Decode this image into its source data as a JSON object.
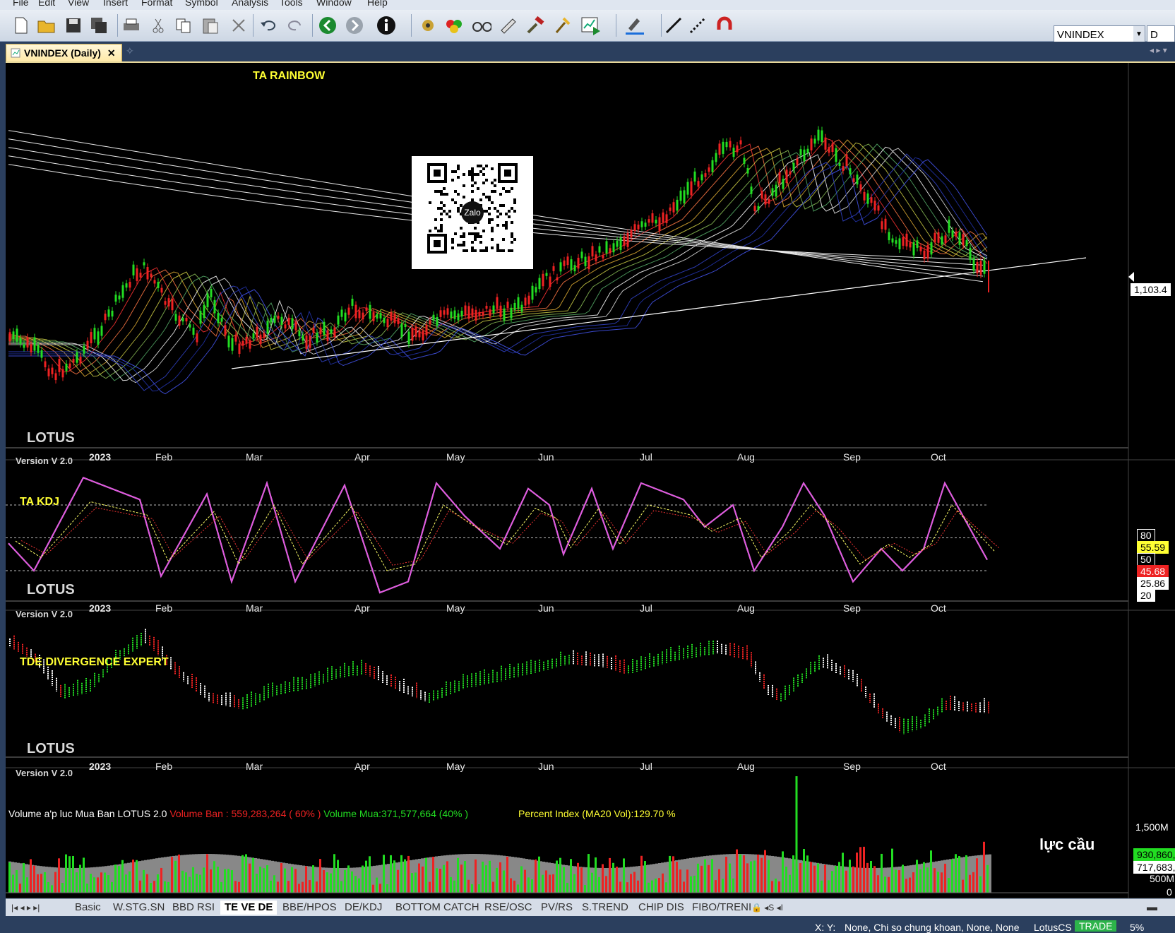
{
  "menu": [
    "File",
    "Edit",
    "View",
    "Insert",
    "Format",
    "Symbol",
    "Analysis",
    "Tools",
    "Window",
    "Help"
  ],
  "toolbar": {
    "icons": [
      "new-file-icon",
      "open-folder-icon",
      "save-icon",
      "save-all-icon",
      "print-icon",
      "cut-icon",
      "copy-icon",
      "paste-icon",
      "delete-icon",
      "undo-icon",
      "redo-icon",
      "back-icon",
      "forward-icon",
      "info-icon",
      "indicator-icon",
      "color-icon",
      "binoculars-icon",
      "wizard-icon",
      "build-icon",
      "tool-icon",
      "strategy-icon",
      "highlight-icon",
      "line-icon",
      "dotted-line-icon",
      "magnet-icon"
    ],
    "symbol": "VNINDEX",
    "period": "D"
  },
  "document_tab": {
    "label": "VNINDEX (Daily)"
  },
  "panes": {
    "price": {
      "title": "TA RAINBOW",
      "brand": "LOTUS",
      "version": "Version V 2.0",
      "price_marker": "1,103.4"
    },
    "kdj": {
      "title": "TA KDJ",
      "brand": "LOTUS",
      "version": "Version V 2.0",
      "levels": [
        "80",
        "55.59",
        "50",
        "45.68",
        "25.86",
        "20"
      ]
    },
    "tde": {
      "title": "TDE DIVERGENCE EXPERT",
      "brand": "LOTUS",
      "version": "Version V 2.0"
    },
    "volume": {
      "label1": "Volume a'p luc Mua Ban LOTUS 2.0",
      "label2": "Volume Ban : 559,283,264 ( 60% )",
      "label3": "Volume Mua:371,577,664 (40% )",
      "label4": "Percent Index (MA20 Vol):129.70 %",
      "annotation": "lực cầu",
      "scale": [
        "1,500M",
        "930,860,",
        "717,683,",
        "500M",
        "0"
      ]
    }
  },
  "x_axis": [
    "2023",
    "Feb",
    "Mar",
    "Apr",
    "May",
    "Jun",
    "Jul",
    "Aug",
    "Sep",
    "Oct"
  ],
  "sheet_tabs": [
    "Basic",
    "W.STG.SN",
    "BBD RSI",
    "TE VE DE",
    "BBE/HPOS",
    "DE/KDJ",
    "BOTTOM CATCH",
    "RSE/OSC",
    "PV/RS",
    "S.TREND",
    "CHIP DIS",
    "FIBO/TRENI"
  ],
  "active_sheet": "TE VE DE",
  "status": {
    "xy": "X: Y:",
    "info": "None, Chi so chung khoan, None, None",
    "user": "LotusCS",
    "mode": "TRADE",
    "zoom": "5%"
  },
  "colors": {
    "accent_yellow": "#ffff33",
    "up": "#22dd22",
    "down": "#ee2222",
    "kdj_k": "#dd44dd",
    "chart_bg": "#000000"
  },
  "qr": {
    "label": "Zalo"
  }
}
